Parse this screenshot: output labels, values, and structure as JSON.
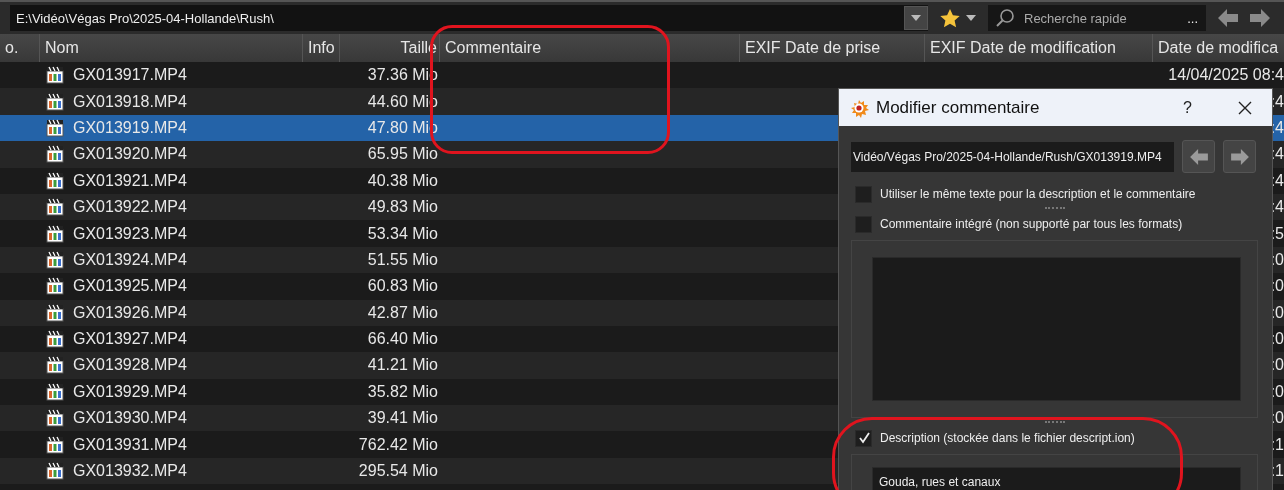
{
  "address_bar": {
    "path": "E:\\Vidéo\\Végas Pro\\2025-04-Hollande\\Rush\\"
  },
  "search": {
    "placeholder": "Recherche rapide",
    "more": "..."
  },
  "columns": [
    {
      "label": "o."
    },
    {
      "label": "Nom"
    },
    {
      "label": "Info"
    },
    {
      "label": "Taille"
    },
    {
      "label": "Commentaire"
    },
    {
      "label": "EXIF Date de prise"
    },
    {
      "label": "EXIF Date de modification"
    },
    {
      "label": "Date de modifica"
    }
  ],
  "rows": [
    {
      "name": "GX013917.MP4",
      "size": "37.36 Mio",
      "date": "14/04/2025 08:4",
      "selected": false
    },
    {
      "name": "GX013918.MP4",
      "size": "44.60 Mio",
      "date": ":4",
      "selected": false
    },
    {
      "name": "GX013919.MP4",
      "size": "47.80 Mio",
      "date": ":4",
      "selected": true
    },
    {
      "name": "GX013920.MP4",
      "size": "65.95 Mio",
      "date": ":4",
      "selected": false
    },
    {
      "name": "GX013921.MP4",
      "size": "40.38 Mio",
      "date": ":4",
      "selected": false
    },
    {
      "name": "GX013922.MP4",
      "size": "49.83 Mio",
      "date": ":4",
      "selected": false
    },
    {
      "name": "GX013923.MP4",
      "size": "53.34 Mio",
      "date": ":5",
      "selected": false
    },
    {
      "name": "GX013924.MP4",
      "size": "51.55 Mio",
      "date": ":0",
      "selected": false
    },
    {
      "name": "GX013925.MP4",
      "size": "60.83 Mio",
      "date": ":0",
      "selected": false
    },
    {
      "name": "GX013926.MP4",
      "size": "42.87 Mio",
      "date": ":0",
      "selected": false
    },
    {
      "name": "GX013927.MP4",
      "size": "66.40 Mio",
      "date": ":0",
      "selected": false
    },
    {
      "name": "GX013928.MP4",
      "size": "41.21 Mio",
      "date": ":0",
      "selected": false
    },
    {
      "name": "GX013929.MP4",
      "size": "35.82 Mio",
      "date": ":0",
      "selected": false
    },
    {
      "name": "GX013930.MP4",
      "size": "39.41 Mio",
      "date": ":0",
      "selected": false
    },
    {
      "name": "GX013931.MP4",
      "size": "762.42 Mio",
      "date": ":1",
      "selected": false
    },
    {
      "name": "GX013932.MP4",
      "size": "295.54 Mio",
      "date": ":1",
      "selected": false
    }
  ],
  "dialog": {
    "title": "Modifier commentaire",
    "help": "?",
    "path": "Vidéo/Végas Pro/2025-04-Hollande/Rush/GX013919.MP4",
    "same_text": {
      "label": "Utiliser le même texte pour la description et le commentaire",
      "checked": false
    },
    "sections": [
      {
        "label": "Commentaire intégré (non supporté par tous les formats)",
        "checked": false
      },
      {
        "label": "Description (stockée dans le fichier descript.ion)",
        "checked": true,
        "value": "Gouda, rues et canaux"
      }
    ]
  }
}
